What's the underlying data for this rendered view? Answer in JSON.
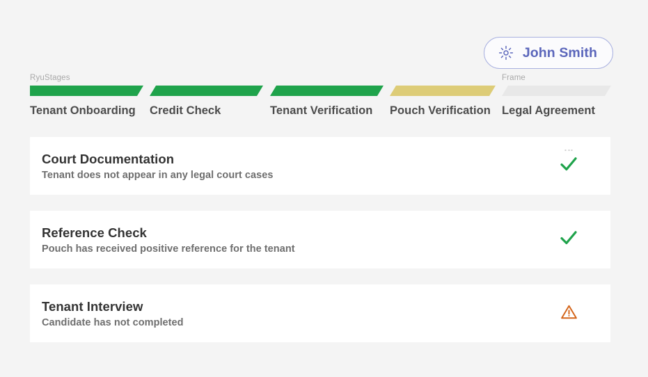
{
  "user": {
    "name": "John Smith",
    "icon": "sun-icon",
    "accent_color": "#5b66bb",
    "border_color": "#a9b1e0"
  },
  "stages": {
    "group_label": "RyuStages",
    "frame_label": "Frame",
    "items": [
      {
        "label": "Tenant Onboarding",
        "state": "complete",
        "color": "#1fa34b"
      },
      {
        "label": "Credit Check",
        "state": "complete",
        "color": "#1fa34b"
      },
      {
        "label": "Tenant Verification",
        "state": "complete",
        "color": "#1fa34b"
      },
      {
        "label": "Pouch Verification",
        "state": "in-progress",
        "color": "#ddcc77"
      },
      {
        "label": "Legal Agreement",
        "state": "pending",
        "color": "#e8e8e8"
      }
    ]
  },
  "checks": [
    {
      "title": "Court Documentation",
      "subtitle": "Tenant does not appear in any legal court cases",
      "status": "passed",
      "status_icon": "check-icon",
      "status_color": "#1fa34b",
      "has_menu_dots": true
    },
    {
      "title": "Reference Check",
      "subtitle": "Pouch has received positive reference for the tenant",
      "status": "passed",
      "status_icon": "check-icon",
      "status_color": "#1fa34b",
      "has_menu_dots": false
    },
    {
      "title": "Tenant Interview",
      "subtitle": "Candidate has not completed",
      "status": "warning",
      "status_icon": "warning-triangle-icon",
      "status_color": "#d4651a",
      "has_menu_dots": false
    }
  ],
  "colors": {
    "page_background": "#f4f4f4",
    "card_background": "#ffffff"
  }
}
